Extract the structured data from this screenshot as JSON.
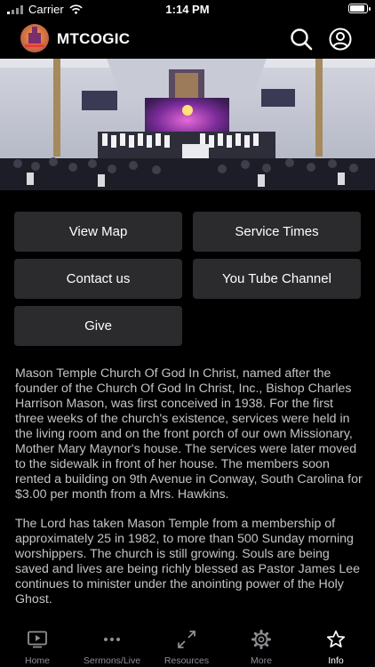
{
  "status_bar": {
    "carrier": "Carrier",
    "time": "1:14 PM"
  },
  "header": {
    "title": "MTCOGIC"
  },
  "buttons": {
    "view_map": "View Map",
    "service_times": "Service Times",
    "contact_us": "Contact us",
    "youtube_channel": "You Tube Channel",
    "give": "Give"
  },
  "about": {
    "paragraph1": "Mason Temple Church Of God In Christ, named after the founder of the Church Of God In Christ, Inc., Bishop Charles Harrison Mason, was first conceived in 1938. For the first three weeks of the church's existence, services were held in the living room and on the front porch of our own Missionary, Mother Mary Maynor's house. The services were later moved to the sidewalk in front of her house. The members soon rented a building on 9th Avenue in Conway, South Carolina for $3.00 per month from a Mrs. Hawkins.",
    "paragraph2": "The Lord has taken Mason Temple from a membership of approximately 25 in 1982, to more than 500 Sunday morning worshippers. The church is still growing. Souls are being saved and lives are being richly blessed as Pastor James Lee continues to minister under the anointing power of the Holy Ghost."
  },
  "tabs": [
    {
      "label": "Home",
      "icon": "tv-play-icon",
      "active": false
    },
    {
      "label": "Sermons/Live",
      "icon": "more-dots-icon",
      "active": false
    },
    {
      "label": "Resources",
      "icon": "expand-arrows-icon",
      "active": false
    },
    {
      "label": "More",
      "icon": "gear-icon",
      "active": false
    },
    {
      "label": "Info",
      "icon": "star-icon",
      "active": true
    }
  ],
  "colors": {
    "background": "#000000",
    "button_bg": "#2b2b2d",
    "body_text": "#c4c4c4",
    "tab_inactive": "#8e8e93",
    "tab_active": "#ffffff"
  }
}
